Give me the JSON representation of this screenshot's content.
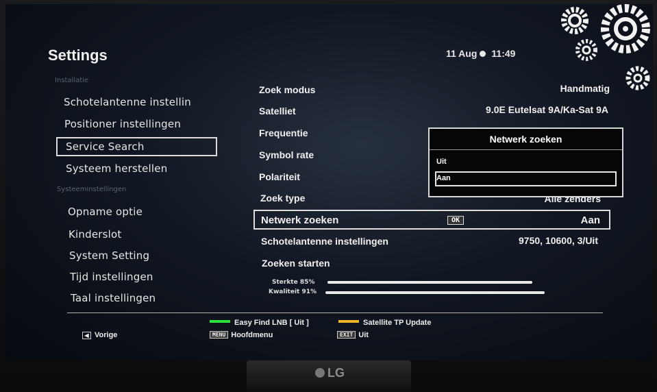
{
  "header": {
    "title": "Settings",
    "date": "11 Aug",
    "time": "11:49"
  },
  "sidebar": {
    "section_install": "Installatie",
    "install_items": [
      "Schotelantenne instellin",
      "Positioner instellingen",
      "Service Search",
      "Systeem herstellen"
    ],
    "section_system": "Systeeminstellingen",
    "system_items": [
      "Opname optie",
      "Kinderslot",
      "System Setting",
      "Tijd instellingen",
      "Taal instellingen"
    ]
  },
  "search": {
    "rows": [
      {
        "label": "Zoek modus",
        "value": "Handmatig"
      },
      {
        "label": "Satelliet",
        "value": "9.0E Eutelsat 9A/Ka-Sat 9A"
      },
      {
        "label": "Frequentie",
        "value": ""
      },
      {
        "label": "Symbol rate",
        "value": ""
      },
      {
        "label": "Polariteit",
        "value": ""
      },
      {
        "label": "Zoek type",
        "value": "Alle zenders"
      },
      {
        "label": "Netwerk zoeken",
        "value": "Aan",
        "ok": "OK"
      },
      {
        "label": "Schotelantenne instellingen",
        "value": "9750, 10600, 3/Uit"
      },
      {
        "label": "Zoeken starten",
        "value": ""
      }
    ],
    "strength_label": "Sterkte",
    "strength_pct": "85%",
    "strength_value": 0.85,
    "quality_label": "Kwaliteit",
    "quality_pct": "91%",
    "quality_value": 0.91
  },
  "popup": {
    "title": "Netwerk zoeken",
    "options": [
      "Uit",
      "Aan"
    ],
    "selected": "Aan"
  },
  "footer": {
    "back_label": "Vorige",
    "green_label": "Easy Find LNB [ Uit ]",
    "yellow_label": "Satellite TP Update",
    "menu_key": "MENU",
    "menu_label": "Hoofdmenu",
    "exit_key": "EXIT",
    "exit_label": "Uit"
  },
  "tv": {
    "brand": "LG"
  },
  "colors": {
    "green_key": "#2ee23c",
    "yellow_key": "#f0b429",
    "highlight_border": "#e0e0e0"
  }
}
